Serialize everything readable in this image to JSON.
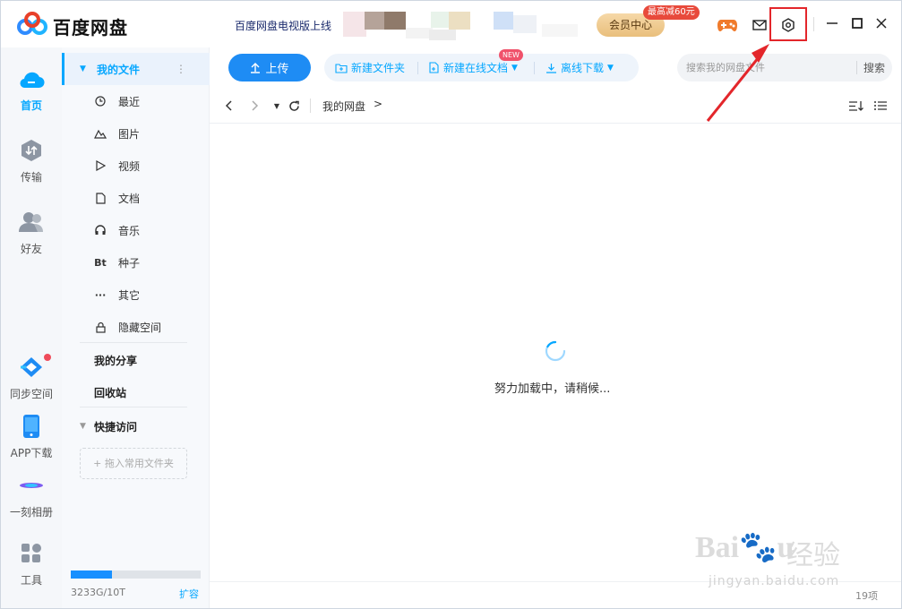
{
  "titlebar": {
    "app_title": "百度网盘",
    "promo_text": "百度网盘电视版上线",
    "vip_label": "会员中心",
    "vip_badge": "最高减60元",
    "icons": [
      "game-icon",
      "mail-icon",
      "settings-icon",
      "minimize-icon",
      "maximize-icon",
      "close-icon"
    ]
  },
  "rail": {
    "items": [
      {
        "label": "首页",
        "icon": "cloud-icon"
      },
      {
        "label": "传输",
        "icon": "transfer-icon"
      },
      {
        "label": "好友",
        "icon": "friends-icon"
      },
      {
        "label": "同步空间",
        "icon": "sync-icon"
      },
      {
        "label": "APP下载",
        "icon": "phone-icon"
      },
      {
        "label": "一刻相册",
        "icon": "album-icon"
      },
      {
        "label": "工具",
        "icon": "tools-icon"
      }
    ]
  },
  "sidebar": {
    "my_files": "我的文件",
    "more": "⋮",
    "items": [
      {
        "label": "最近",
        "icon": "clock-icon"
      },
      {
        "label": "图片",
        "icon": "image-icon"
      },
      {
        "label": "视频",
        "icon": "video-icon"
      },
      {
        "label": "文档",
        "icon": "document-icon"
      },
      {
        "label": "音乐",
        "icon": "headphones-icon"
      },
      {
        "label": "种子",
        "icon": "bt-icon",
        "glyph": "Bt"
      },
      {
        "label": "其它",
        "icon": "more-dots-icon",
        "glyph": "···"
      },
      {
        "label": "隐藏空间",
        "icon": "lock-icon"
      }
    ],
    "my_share": "我的分享",
    "recycle": "回收站",
    "quick_access": "快捷访问",
    "drop_hint": "+ 拖入常用文件夹",
    "storage_text": "3233G/10T",
    "storage_fraction": 0.32,
    "expand": "扩容"
  },
  "toolbar": {
    "upload": "上传",
    "new_folder": "新建文件夹",
    "new_online_doc": "新建在线文档",
    "new_badge": "NEW",
    "offline_download": "离线下载",
    "search_placeholder": "搜索我的网盘文件",
    "search_button": "搜索"
  },
  "navbar": {
    "breadcrumb": "我的网盘",
    "crumb_arrow": ">"
  },
  "main": {
    "loading": "努力加载中，请稍候...",
    "count": "19项"
  },
  "colors": {
    "accent": "#06a7ff",
    "upload": "#1e8cf4",
    "annotation": "#e3262b"
  }
}
